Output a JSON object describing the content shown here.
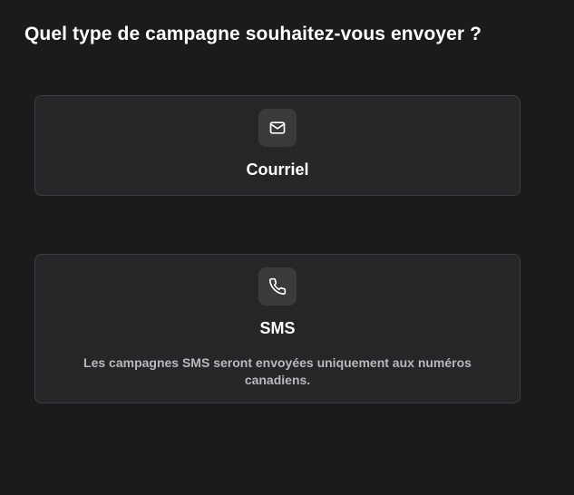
{
  "page": {
    "title": "Quel type de campagne souhaitez-vous envoyer ?"
  },
  "options": [
    {
      "label": "Courriel",
      "icon": "envelope-icon",
      "description": ""
    },
    {
      "label": "SMS",
      "icon": "phone-icon",
      "description": "Les campagnes SMS seront envoyées uniquement aux numéros canadiens."
    }
  ],
  "colors": {
    "background": "#1b1b1d",
    "card": "#262628",
    "card_border": "#3e3e42",
    "icon_box": "#3a3a3d",
    "text": "#ffffff",
    "muted_text": "#b9b9bd"
  }
}
